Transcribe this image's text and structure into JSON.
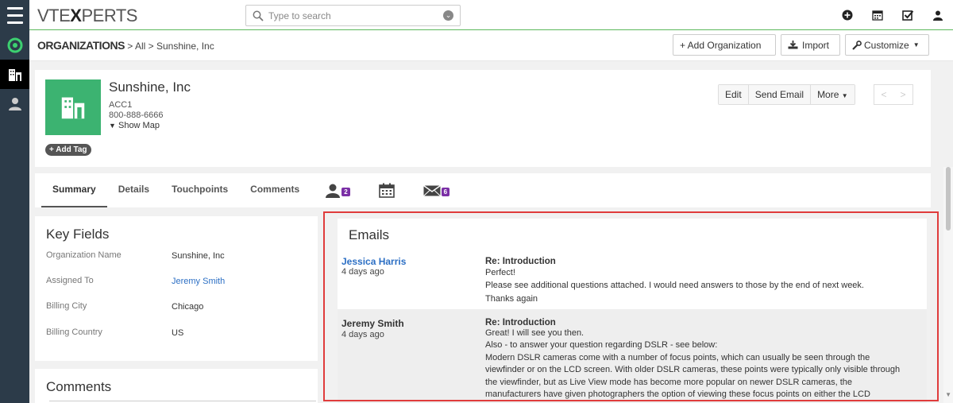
{
  "app": {
    "logo_prefix": "VTE",
    "logo_x": "X",
    "logo_suffix": "PERTS"
  },
  "search": {
    "placeholder": "Type to search"
  },
  "breadcrumb": {
    "module": "ORGANIZATIONS",
    "sep1": ">",
    "filter": "All",
    "sep2": ">",
    "record": "Sunshine, Inc"
  },
  "header_buttons": {
    "add": "+ Add Organization",
    "import": "Import",
    "customize": "Customize"
  },
  "record": {
    "name": "Sunshine, Inc",
    "account_no": "ACC1",
    "phone": "800-888-6666",
    "show_map": "Show Map",
    "add_tag": "+ Add Tag"
  },
  "record_actions": {
    "edit": "Edit",
    "send_email": "Send Email",
    "more": "More",
    "prev": "<",
    "next": ">"
  },
  "tabs": {
    "summary": "Summary",
    "details": "Details",
    "touchpoints": "Touchpoints",
    "comments": "Comments",
    "contacts_count": "2",
    "emails_count": "6"
  },
  "key_fields": {
    "title": "Key Fields",
    "rows": [
      {
        "label": "Organization Name",
        "value": "Sunshine, Inc"
      },
      {
        "label": "Assigned To",
        "value": "Jeremy Smith"
      },
      {
        "label": "Billing City",
        "value": "Chicago"
      },
      {
        "label": "Billing Country",
        "value": "US"
      }
    ]
  },
  "comments_panel": {
    "title": "Comments"
  },
  "emails": {
    "title": "Emails",
    "items": [
      {
        "from": "Jessica Harris",
        "date": "4 days ago",
        "subject": "Re: Introduction",
        "lines": [
          "Perfect!",
          "Please see additional questions attached. I would need answers to those by the end of next week.",
          "Thanks again"
        ]
      },
      {
        "from": "Jeremy Smith",
        "date": "4 days ago",
        "subject": "Re: Introduction",
        "lines": [
          "Great! I will see you then.",
          "Also - to answer your question regarding DSLR - see below:",
          "Modern DSLR cameras come with a number of focus points, which can usually be seen through the",
          "viewfinder or on the LCD screen. With older DSLR cameras, these points were typically only visible through",
          "the viewfinder, but as Live View mode has become more popular on newer DSLR cameras, the",
          "manufacturers have given photographers the option of viewing these focus points on either the LCD"
        ]
      }
    ]
  },
  "colors": {
    "rail": "#2c3b49",
    "accent_green": "#3cb371",
    "link": "#2c6fc4",
    "badge": "#7b2fa6",
    "highlight": "#e03c3c"
  }
}
